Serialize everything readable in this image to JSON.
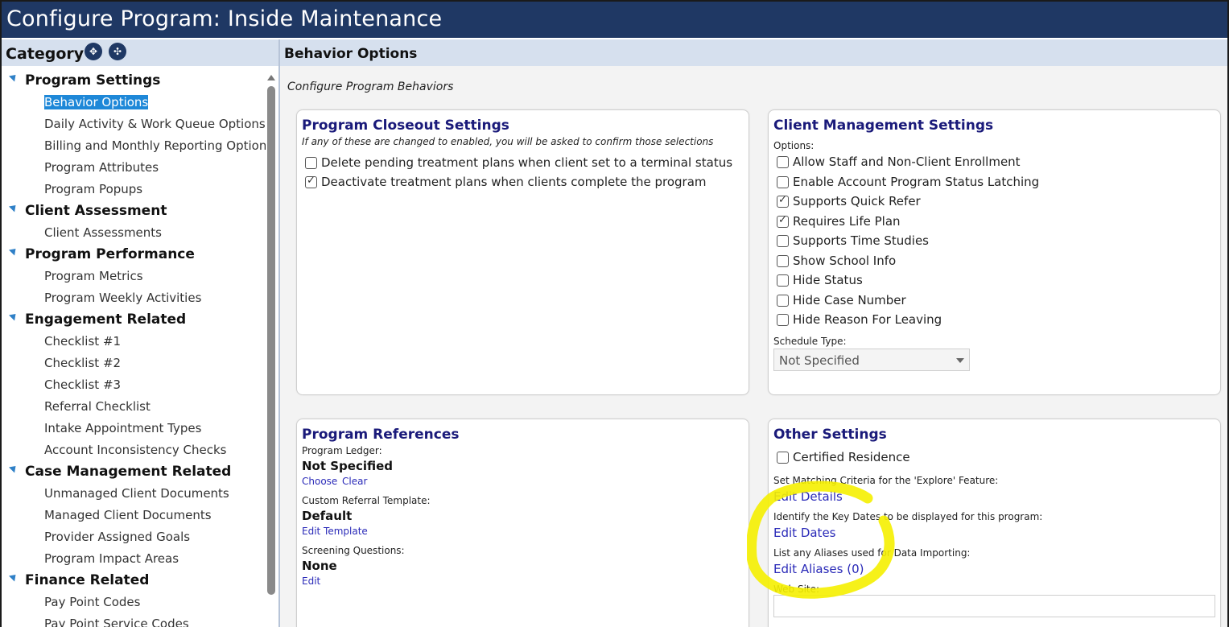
{
  "title": "Configure Program: Inside Maintenance",
  "left": {
    "header": "Category",
    "icons": [
      "expand-all-icon",
      "collapse-all-icon"
    ],
    "groups": [
      {
        "label": "Program Settings",
        "items": [
          "Behavior Options",
          "Daily Activity & Work Queue Options",
          "Billing and Monthly Reporting Options",
          "Program Attributes",
          "Program Popups"
        ]
      },
      {
        "label": "Client Assessment",
        "items": [
          "Client Assessments"
        ]
      },
      {
        "label": "Program Performance",
        "items": [
          "Program Metrics",
          "Program Weekly Activities"
        ]
      },
      {
        "label": "Engagement Related",
        "items": [
          "Checklist #1",
          "Checklist #2",
          "Checklist #3",
          "Referral Checklist",
          "Intake Appointment Types",
          "Account Inconsistency Checks"
        ]
      },
      {
        "label": "Case Management Related",
        "items": [
          "Unmanaged Client Documents",
          "Managed Client Documents",
          "Provider Assigned Goals",
          "Program Impact Areas"
        ]
      },
      {
        "label": "Finance Related",
        "items": [
          "Pay Point Codes",
          "Pay Point Service Codes"
        ]
      }
    ],
    "selected": "Behavior Options"
  },
  "right": {
    "header": "Behavior Options",
    "subtitle": "Configure Program Behaviors",
    "closeout": {
      "title": "Program Closeout Settings",
      "note": "If any of these are changed to enabled, you will be asked to confirm those selections",
      "options": [
        {
          "label": "Delete pending treatment plans when client set to a terminal status",
          "checked": false
        },
        {
          "label": "Deactivate treatment plans when clients complete the program",
          "checked": true
        }
      ]
    },
    "client_mgmt": {
      "title": "Client Management Settings",
      "options_label": "Options:",
      "options": [
        {
          "label": "Allow Staff and Non-Client Enrollment",
          "checked": false
        },
        {
          "label": "Enable Account Program Status Latching",
          "checked": false
        },
        {
          "label": "Supports Quick Refer",
          "checked": true
        },
        {
          "label": "Requires Life Plan",
          "checked": true
        },
        {
          "label": "Supports Time Studies",
          "checked": false
        },
        {
          "label": "Show School Info",
          "checked": false
        },
        {
          "label": "Hide Status",
          "checked": false
        },
        {
          "label": "Hide Case Number",
          "checked": false
        },
        {
          "label": "Hide Reason For Leaving",
          "checked": false
        }
      ],
      "schedule_label": "Schedule Type:",
      "schedule_value": "Not Specified"
    },
    "references": {
      "title": "Program References",
      "ledger_label": "Program Ledger:",
      "ledger_value": "Not Specified",
      "choose": "Choose",
      "clear": "Clear",
      "template_label": "Custom Referral Template:",
      "template_value": "Default",
      "edit_template": "Edit Template",
      "screening_label": "Screening Questions:",
      "screening_value": "None",
      "edit": "Edit"
    },
    "other": {
      "title": "Other Settings",
      "certified": {
        "label": "Certified Residence",
        "checked": false
      },
      "matching_label": "Set Matching Criteria for the 'Explore' Feature:",
      "edit_details": "Edit Details",
      "dates_label": "Identify the Key Dates to be displayed for this program:",
      "edit_dates": "Edit Dates",
      "aliases_label": "List any Aliases used for Data Importing:",
      "edit_aliases": "Edit Aliases (0)",
      "website_label": "Web Site:",
      "website_value": ""
    },
    "annotation_color": "#f5f000"
  }
}
